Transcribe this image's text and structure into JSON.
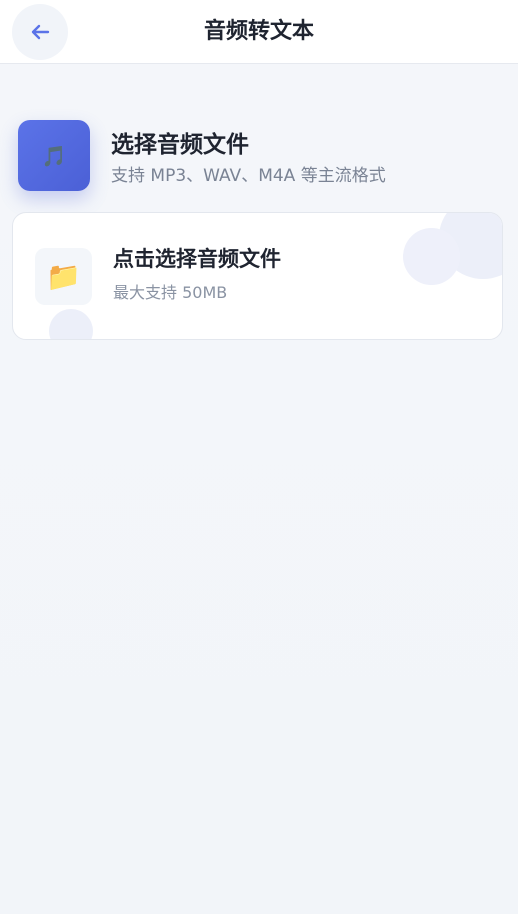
{
  "header": {
    "title": "音频转文本",
    "back_icon": "arrow-left-icon",
    "accent_color": "#5b73e8"
  },
  "section": {
    "icon": "music-note-icon",
    "icon_glyph": "🎵",
    "title": "选择音频文件",
    "subtitle": "支持 MP3、WAV、M4A 等主流格式"
  },
  "upload_card": {
    "icon": "folder-icon",
    "icon_glyph": "📁",
    "title": "点击选择音频文件",
    "subtitle": "最大支持 50MB"
  }
}
